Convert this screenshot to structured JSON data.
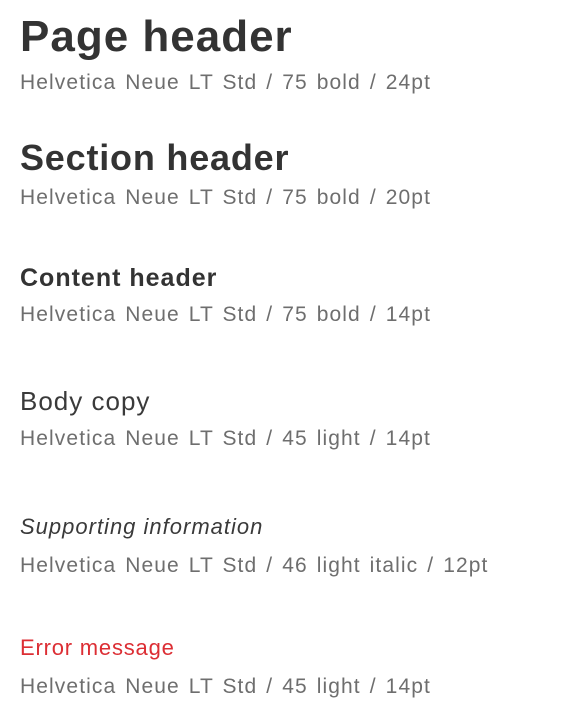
{
  "colors": {
    "heading": "#333333",
    "body": "#3a3a3a",
    "spec_text": "#6e6e6e",
    "error": "#dc2e34",
    "background": "#ffffff"
  },
  "specimens": [
    {
      "sample": "Page header",
      "font": "Helvetica Neue LT Std",
      "weight": "75 bold",
      "size": "24pt"
    },
    {
      "sample": "Section header",
      "font": "Helvetica Neue LT Std",
      "weight": "75 bold",
      "size": "20pt"
    },
    {
      "sample": "Content header",
      "font": "Helvetica Neue LT Std",
      "weight": "75 bold",
      "size": "14pt"
    },
    {
      "sample": "Body copy",
      "font": "Helvetica Neue LT Std",
      "weight": "45 light",
      "size": "14pt"
    },
    {
      "sample": "Supporting information",
      "font": "Helvetica Neue LT Std",
      "weight": "46 light italic",
      "size": "12pt"
    },
    {
      "sample": "Error message",
      "font": "Helvetica Neue LT Std",
      "weight": "45 light",
      "size": "14pt"
    }
  ]
}
